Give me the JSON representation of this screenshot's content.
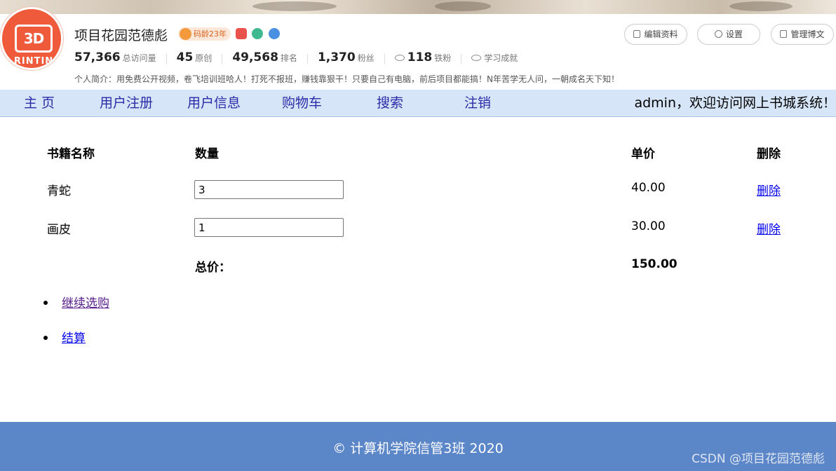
{
  "profile": {
    "avatar_text": "3D",
    "avatar_word": "RINTIN",
    "name": "项目花园范德彪",
    "badge": "码龄23年",
    "stats": [
      {
        "num": "57,366",
        "label": "总访问量"
      },
      {
        "num": "45",
        "label": "原创"
      },
      {
        "num": "49,568",
        "label": "排名"
      },
      {
        "num": "1,370",
        "label": "粉丝"
      },
      {
        "num": "118",
        "label": "铁粉"
      }
    ],
    "achievement": "学习成就",
    "intro": "个人简介：用免费公开视频，卷飞培训班哈人！打死不报班，赚钱靠狠干！只要自己有电脑，前后项目都能搞！N年苦学无人问，一朝成名天下知！",
    "buttons": {
      "edit": "编辑资料",
      "settings": "设置",
      "manage": "管理博文"
    }
  },
  "nav": {
    "items": [
      "主 页",
      "用户注册",
      "用户信息",
      "购物车",
      "搜索",
      "注销"
    ],
    "welcome": "admin，欢迎访问网上书城系统！"
  },
  "cart": {
    "headers": {
      "name": "书籍名称",
      "qty": "数量",
      "price": "单价",
      "delete": "删除"
    },
    "rows": [
      {
        "name": "青蛇",
        "qty": "3",
        "price": "40.00",
        "delete": "删除"
      },
      {
        "name": "画皮",
        "qty": "1",
        "price": "30.00",
        "delete": "删除"
      }
    ],
    "total_label": "总价：",
    "total": "150.00"
  },
  "actions": {
    "continue": "继续选购",
    "checkout": "结算"
  },
  "footer": {
    "text": "© 计算机学院信管3班 2020",
    "watermark": "CSDN @项目花园范德彪"
  },
  "colors": {
    "nav_bg": "#d6e6f8",
    "nav_link": "#2f2aa8",
    "footer_bg": "#5b86c8",
    "avatar": "#ef5a3a"
  }
}
